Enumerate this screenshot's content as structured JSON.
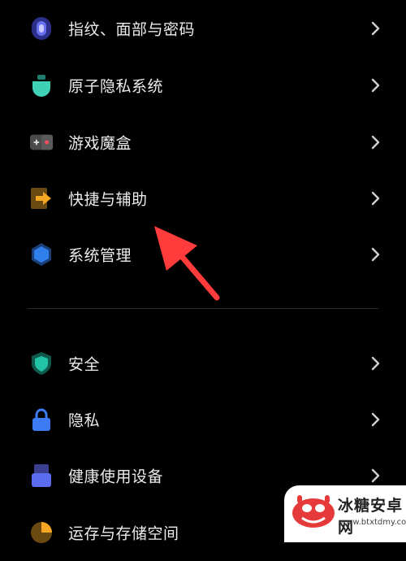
{
  "group1": {
    "items": [
      {
        "label": "指纹、面部与密码",
        "icon": "fingerprint-icon",
        "color": "#5b5fd6"
      },
      {
        "label": "原子隐私系统",
        "icon": "privacy-atom-icon",
        "color": "#3fd1b5"
      },
      {
        "label": "游戏魔盒",
        "icon": "game-box-icon",
        "color": "#4a4a4a"
      },
      {
        "label": "快捷与辅助",
        "icon": "shortcut-assist-icon",
        "color": "#f5a623"
      },
      {
        "label": "系统管理",
        "icon": "system-management-icon",
        "color": "#2f80ed"
      }
    ]
  },
  "group2": {
    "items": [
      {
        "label": "安全",
        "icon": "shield-icon",
        "color": "#22c3a6"
      },
      {
        "label": "隐私",
        "icon": "lock-icon",
        "color": "#3d7bf5"
      },
      {
        "label": "健康使用设备",
        "icon": "health-usage-icon",
        "color": "#5b6cf0"
      },
      {
        "label": "运存与存储空间",
        "icon": "storage-pie-icon",
        "color": "#f5a623"
      }
    ]
  },
  "annotation": {
    "arrow_color": "#ff3b3b"
  },
  "watermark": {
    "title": "冰糖安卓网",
    "url": "www.btxtdmy.com"
  }
}
